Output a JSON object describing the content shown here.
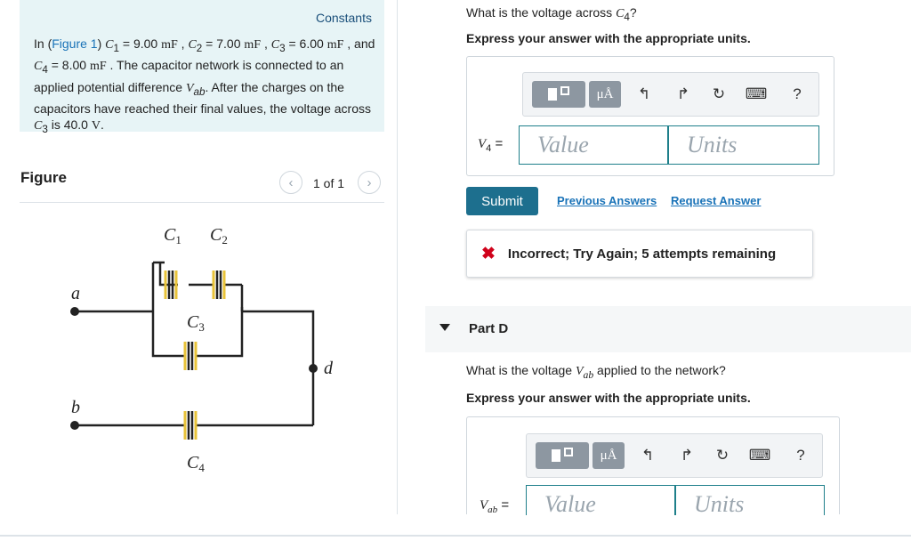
{
  "intro": {
    "constants_label": "Constants",
    "text_prefix": "In (",
    "figure_link": "Figure 1",
    "text_after_link": ") ",
    "values": {
      "c1": "9.00",
      "c2": "7.00",
      "c3": "6.00",
      "c4": "8.00",
      "unit": "mF",
      "v3": "40.0",
      "v_unit": "V"
    },
    "t1": " = ",
    "t2": " , ",
    "t3": " = ",
    "t4": " ,",
    "t5": " = ",
    "t6": " , and ",
    "t7": " = ",
    "t8": " . The capacitor network is connected to an applied potential difference ",
    "t9": ". After the charges on the capacitors have reached their final values, the voltage across ",
    "t10": " is "
  },
  "figure": {
    "label": "Figure",
    "pager": "1 of 1",
    "labels": {
      "c1": "C",
      "c1_sub": "1",
      "c2": "C",
      "c2_sub": "2",
      "c3": "C",
      "c3_sub": "3",
      "c4": "C",
      "c4_sub": "4",
      "a": "a",
      "b": "b",
      "d": "d"
    }
  },
  "partc": {
    "question_prefix": "What is the voltage across ",
    "question_var": "C",
    "question_sub": "4",
    "question_suffix": "?",
    "instruction": "Express your answer with the appropriate units.",
    "field_label_var": "V",
    "field_label_sub": "4",
    "field_label_eq": " =",
    "value_placeholder": "Value",
    "units_placeholder": "Units",
    "unit_button": "μÅ",
    "help": "?"
  },
  "actions": {
    "submit": "Submit",
    "previous_answers": "Previous Answers",
    "request_answer": "Request Answer"
  },
  "feedback": {
    "icon": "✖",
    "text": "Incorrect; Try Again; 5 attempts remaining"
  },
  "partd": {
    "title": "Part D",
    "question_prefix": "What is the voltage ",
    "question_var": "V",
    "question_sub": "ab",
    "question_suffix": " applied to the network?",
    "instruction": "Express your answer with the appropriate units.",
    "field_label_var": "V",
    "field_label_sub": "ab",
    "field_label_eq": " =",
    "value_placeholder": "Value",
    "units_placeholder": "Units",
    "unit_button": "μÅ",
    "help": "?"
  },
  "colors": {
    "accent": "#1d6f8e",
    "link": "#1a73b8",
    "error": "#d0021b",
    "intro_bg": "#e7f4f6",
    "capacitor": "#e8c33a"
  }
}
